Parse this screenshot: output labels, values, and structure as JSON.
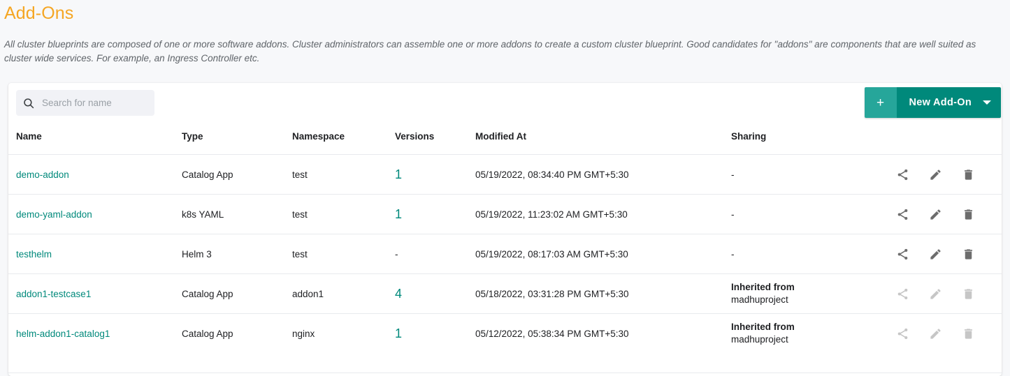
{
  "header": {
    "title": "Add-Ons",
    "description": "All cluster blueprints are composed of one or more software addons. Cluster administrators can assemble one or more addons to create a custom cluster blueprint. Good candidates for \"addons\" are components that are well suited as cluster wide services. For example, an Ingress Controller etc."
  },
  "toolbar": {
    "search_placeholder": "Search for name",
    "search_value": "",
    "search_icon": "search-icon",
    "new_button_plus": "+",
    "new_button_label": "New Add-On",
    "new_button_caret_icon": "chevron-down-icon",
    "colors": {
      "accent_teal": "#00897b",
      "accent_teal_light": "#26a69a",
      "title_orange": "#f5a623"
    }
  },
  "table": {
    "columns": [
      "Name",
      "Type",
      "Namespace",
      "Versions",
      "Modified At",
      "Sharing",
      ""
    ],
    "row_actions": [
      {
        "icon": "share-icon",
        "label": "Share"
      },
      {
        "icon": "pencil-icon",
        "label": "Edit"
      },
      {
        "icon": "trash-icon",
        "label": "Delete"
      }
    ],
    "rows": [
      {
        "name": "demo-addon",
        "type": "Catalog App",
        "namespace": "test",
        "versions": "1",
        "versions_is_link": true,
        "modified_at": "05/19/2022, 08:34:40 PM GMT+5:30",
        "sharing_title": "-",
        "sharing_sub": "",
        "actions_enabled": true
      },
      {
        "name": "demo-yaml-addon",
        "type": "k8s YAML",
        "namespace": "test",
        "versions": "1",
        "versions_is_link": true,
        "modified_at": "05/19/2022, 11:23:02 AM GMT+5:30",
        "sharing_title": "-",
        "sharing_sub": "",
        "actions_enabled": true
      },
      {
        "name": "testhelm",
        "type": "Helm 3",
        "namespace": "test",
        "versions": "-",
        "versions_is_link": false,
        "modified_at": "05/19/2022, 08:17:03 AM GMT+5:30",
        "sharing_title": "-",
        "sharing_sub": "",
        "actions_enabled": true
      },
      {
        "name": "addon1-testcase1",
        "type": "Catalog App",
        "namespace": "addon1",
        "versions": "4",
        "versions_is_link": true,
        "modified_at": "05/18/2022, 03:31:28 PM GMT+5:30",
        "sharing_title": "Inherited from",
        "sharing_sub": "madhuproject",
        "actions_enabled": false
      },
      {
        "name": "helm-addon1-catalog1",
        "type": "Catalog App",
        "namespace": "nginx",
        "versions": "1",
        "versions_is_link": true,
        "modified_at": "05/12/2022, 05:38:34 PM GMT+5:30",
        "sharing_title": "Inherited from",
        "sharing_sub": "madhuproject",
        "actions_enabled": false
      }
    ]
  }
}
